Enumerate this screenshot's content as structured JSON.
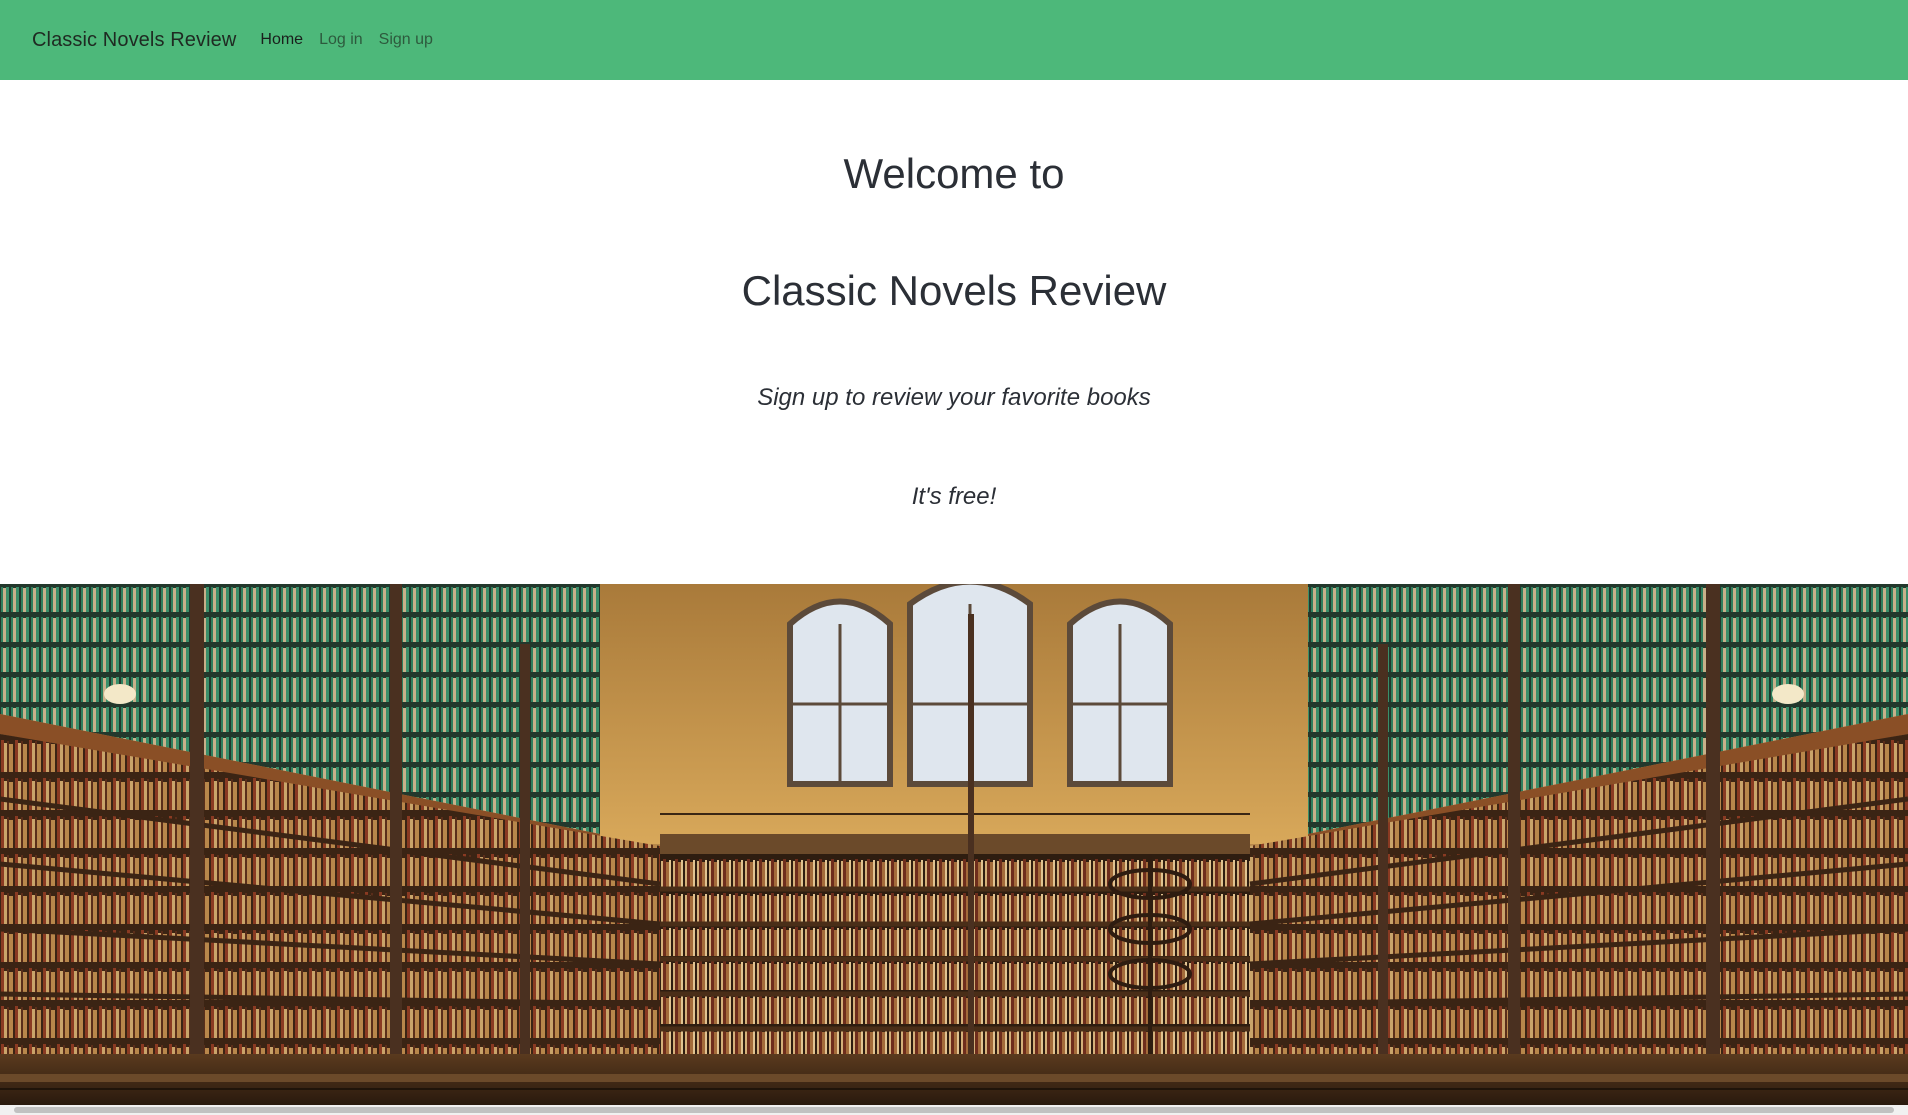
{
  "navbar": {
    "brand": "Classic Novels Review",
    "links": [
      {
        "label": "Home",
        "active": true
      },
      {
        "label": "Log in",
        "active": false
      },
      {
        "label": "Sign up",
        "active": false
      }
    ],
    "background_color": "#4db87a"
  },
  "hero": {
    "welcome": "Welcome to",
    "title": "Classic Novels Review",
    "tagline": "Sign up to review your favorite books",
    "free_note": "It's free!"
  },
  "image": {
    "name": "library-photo"
  }
}
